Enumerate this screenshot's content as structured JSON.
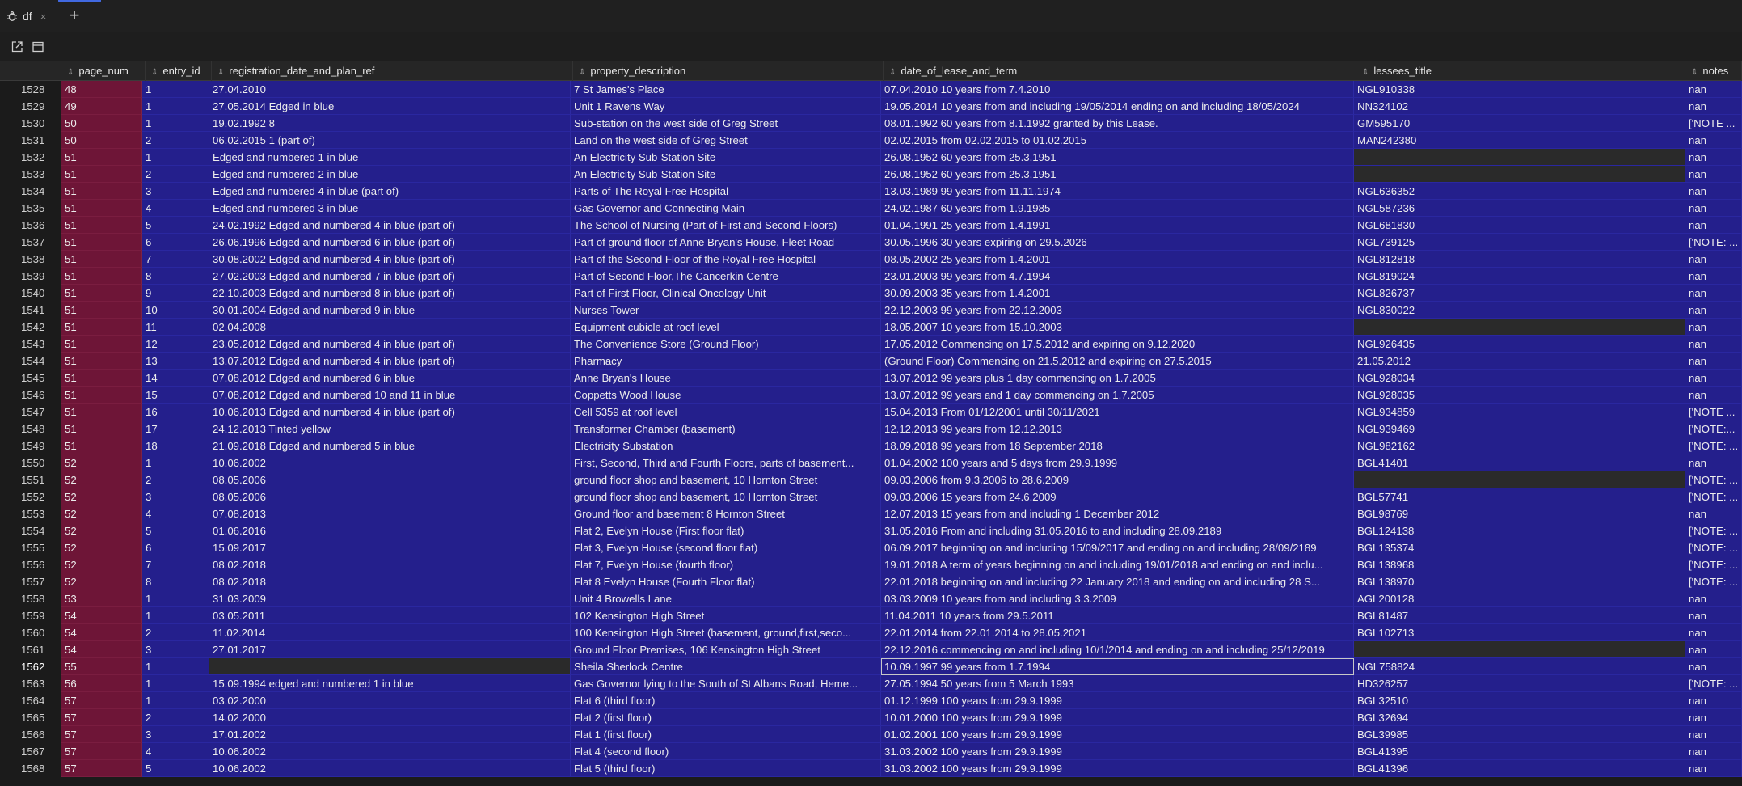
{
  "tab": {
    "title": "df",
    "close_symbol": "×",
    "new_tab_symbol": "+"
  },
  "toolbar": {
    "open_external_icon": "open-external-icon",
    "panel_icon": "panel-icon"
  },
  "columns": [
    "page_num",
    "entry_id",
    "registration_date_and_plan_ref",
    "property_description",
    "date_of_lease_and_term",
    "lessees_title",
    "notes"
  ],
  "rows": [
    [
      "1528",
      "48",
      "1",
      "27.04.2010",
      "7 St James's Place",
      "07.04.2010 10 years from 7.4.2010",
      "NGL910338",
      "nan"
    ],
    [
      "1529",
      "49",
      "1",
      "27.05.2014 Edged in blue",
      "Unit 1 Ravens Way",
      "19.05.2014 10 years from and including 19/05/2014 ending on and including 18/05/2024",
      "NN324102",
      "nan"
    ],
    [
      "1530",
      "50",
      "1",
      "19.02.1992 8",
      "Sub-station on the west side of Greg Street",
      "08.01.1992 60 years from 8.1.1992 granted by this Lease.",
      "GM595170",
      "['NOTE ..."
    ],
    [
      "1531",
      "50",
      "2",
      "06.02.2015 1 (part of)",
      "Land on the west side of Greg Street",
      "02.02.2015 from 02.02.2015 to 01.02.2015",
      "MAN242380",
      "nan"
    ],
    [
      "1532",
      "51",
      "1",
      "Edged and numbered 1 in blue",
      "An Electricity Sub-Station Site",
      "26.08.1952 60 years from 25.3.1951",
      "",
      "nan"
    ],
    [
      "1533",
      "51",
      "2",
      "Edged and numbered 2 in blue",
      "An Electricity Sub-Station Site",
      "26.08.1952 60 years from 25.3.1951",
      "",
      "nan"
    ],
    [
      "1534",
      "51",
      "3",
      "Edged and numbered 4 in blue (part of)",
      "Parts of The Royal Free Hospital",
      "13.03.1989 99 years from 11.11.1974",
      "NGL636352",
      "nan"
    ],
    [
      "1535",
      "51",
      "4",
      "Edged and numbered 3 in blue",
      "Gas Governor and Connecting Main",
      "24.02.1987 60 years from 1.9.1985",
      "NGL587236",
      "nan"
    ],
    [
      "1536",
      "51",
      "5",
      "24.02.1992 Edged and numbered 4 in blue (part of)",
      "The School of Nursing (Part of First and Second Floors)",
      "01.04.1991 25 years from 1.4.1991",
      "NGL681830",
      "nan"
    ],
    [
      "1537",
      "51",
      "6",
      "26.06.1996 Edged and numbered 6 in blue (part of)",
      "Part of ground floor of Anne Bryan's House, Fleet Road",
      "30.05.1996 30 years expiring on 29.5.2026",
      "NGL739125",
      "['NOTE: ..."
    ],
    [
      "1538",
      "51",
      "7",
      "30.08.2002 Edged and numbered 4 in blue (part of)",
      "Part of the Second Floor of the Royal Free Hospital",
      "08.05.2002 25 years from 1.4.2001",
      "NGL812818",
      "nan"
    ],
    [
      "1539",
      "51",
      "8",
      "27.02.2003 Edged and numbered 7 in blue (part of)",
      "Part of Second Floor,The Cancerkin Centre",
      "23.01.2003 99 years from 4.7.1994",
      "NGL819024",
      "nan"
    ],
    [
      "1540",
      "51",
      "9",
      "22.10.2003 Edged and numbered 8 in blue (part of)",
      "Part of First Floor, Clinical Oncology Unit",
      "30.09.2003 35 years from 1.4.2001",
      "NGL826737",
      "nan"
    ],
    [
      "1541",
      "51",
      "10",
      "30.01.2004 Edged and numbered 9 in blue",
      "Nurses Tower",
      "22.12.2003 99 years from 22.12.2003",
      "NGL830022",
      "nan"
    ],
    [
      "1542",
      "51",
      "11",
      "02.04.2008",
      "Equipment cubicle at roof level",
      "18.05.2007 10 years from 15.10.2003",
      "",
      "nan"
    ],
    [
      "1543",
      "51",
      "12",
      "23.05.2012 Edged and numbered 4 in blue (part of)",
      "The Convenience Store (Ground Floor)",
      "17.05.2012 Commencing on 17.5.2012 and expiring on 9.12.2020",
      "NGL926435",
      "nan"
    ],
    [
      "1544",
      "51",
      "13",
      "13.07.2012 Edged and numbered 4 in blue (part of)",
      "Pharmacy",
      "(Ground Floor) Commencing on 21.5.2012 and expiring on 27.5.2015",
      "21.05.2012",
      "nan"
    ],
    [
      "1545",
      "51",
      "14",
      "07.08.2012 Edged and numbered 6 in blue",
      "Anne Bryan's House",
      "13.07.2012 99 years plus 1 day commencing on 1.7.2005",
      "NGL928034",
      "nan"
    ],
    [
      "1546",
      "51",
      "15",
      "07.08.2012 Edged and numbered 10 and 11 in blue",
      "Coppetts Wood House",
      "13.07.2012 99 years and 1 day commencing on 1.7.2005",
      "NGL928035",
      "nan"
    ],
    [
      "1547",
      "51",
      "16",
      "10.06.2013 Edged and numbered 4 in blue (part of)",
      "Cell 5359 at roof level",
      "15.04.2013 From 01/12/2001 until 30/11/2021",
      "NGL934859",
      "['NOTE ..."
    ],
    [
      "1548",
      "51",
      "17",
      "24.12.2013 Tinted yellow",
      "Transformer Chamber (basement)",
      "12.12.2013 99 years from 12.12.2013",
      "NGL939469",
      "['NOTE:..."
    ],
    [
      "1549",
      "51",
      "18",
      "21.09.2018 Edged and numbered 5 in blue",
      "Electricity Substation",
      "18.09.2018 99 years from 18 September 2018",
      "NGL982162",
      "['NOTE: ..."
    ],
    [
      "1550",
      "52",
      "1",
      "10.06.2002",
      "First, Second, Third and Fourth Floors, parts of basement...",
      "01.04.2002 100 years and 5 days from 29.9.1999",
      "BGL41401",
      "nan"
    ],
    [
      "1551",
      "52",
      "2",
      "08.05.2006",
      "ground floor shop and basement, 10 Hornton Street",
      "09.03.2006 from 9.3.2006 to 28.6.2009",
      "",
      "['NOTE: ..."
    ],
    [
      "1552",
      "52",
      "3",
      "08.05.2006",
      "ground floor shop and basement, 10 Hornton Street",
      "09.03.2006 15 years from 24.6.2009",
      "BGL57741",
      "['NOTE: ..."
    ],
    [
      "1553",
      "52",
      "4",
      "07.08.2013",
      "Ground floor and basement 8 Hornton Street",
      "12.07.2013 15 years from and including 1 December 2012",
      "BGL98769",
      "nan"
    ],
    [
      "1554",
      "52",
      "5",
      "01.06.2016",
      "Flat 2, Evelyn House (First floor flat)",
      "31.05.2016 From and including 31.05.2016 to and including 28.09.2189",
      "BGL124138",
      "['NOTE: ..."
    ],
    [
      "1555",
      "52",
      "6",
      "15.09.2017",
      "Flat 3, Evelyn House (second floor flat)",
      "06.09.2017 beginning on and including 15/09/2017 and ending on and including 28/09/2189",
      "BGL135374",
      "['NOTE: ..."
    ],
    [
      "1556",
      "52",
      "7",
      "08.02.2018",
      "Flat 7, Evelyn House (fourth floor)",
      "19.01.2018 A term of years beginning on and including 19/01/2018 and ending on and inclu...",
      "BGL138968",
      "['NOTE: ..."
    ],
    [
      "1557",
      "52",
      "8",
      "08.02.2018",
      "Flat 8 Evelyn House (Fourth Floor flat)",
      "22.01.2018 beginning on and including 22 January 2018 and ending on and including 28 S...",
      "BGL138970",
      "['NOTE: ..."
    ],
    [
      "1558",
      "53",
      "1",
      "31.03.2009",
      "Unit 4 Browells Lane",
      "03.03.2009 10 years from and including 3.3.2009",
      "AGL200128",
      "nan"
    ],
    [
      "1559",
      "54",
      "1",
      "03.05.2011",
      "102 Kensington High Street",
      "11.04.2011 10 years from 29.5.2011",
      "BGL81487",
      "nan"
    ],
    [
      "1560",
      "54",
      "2",
      "11.02.2014",
      "100 Kensington High Street (basement, ground,first,seco...",
      "22.01.2014 from 22.01.2014 to 28.05.2021",
      "BGL102713",
      "nan"
    ],
    [
      "1561",
      "54",
      "3",
      "27.01.2017",
      "Ground Floor Premises, 106 Kensington High Street",
      "22.12.2016 commencing on and including 10/1/2014 and ending on and including 25/12/2019",
      "",
      "nan"
    ],
    [
      "1562",
      "55",
      "1",
      "",
      "Sheila Sherlock Centre",
      "10.09.1997 99 years from 1.7.1994",
      "NGL758824",
      "nan"
    ],
    [
      "1563",
      "56",
      "1",
      "15.09.1994 edged and numbered 1 in blue",
      "Gas Governor lying to the South of St Albans Road, Heme...",
      "27.05.1994 50 years from 5 March 1993",
      "HD326257",
      "['NOTE: ..."
    ],
    [
      "1564",
      "57",
      "1",
      "03.02.2000",
      "Flat 6 (third floor)",
      "01.12.1999 100 years from 29.9.1999",
      "BGL32510",
      "nan"
    ],
    [
      "1565",
      "57",
      "2",
      "14.02.2000",
      "Flat 2 (first floor)",
      "10.01.2000 100 years from 29.9.1999",
      "BGL32694",
      "nan"
    ],
    [
      "1566",
      "57",
      "3",
      "17.01.2002",
      "Flat 1 (first floor)",
      "01.02.2001 100 years from 29.9.1999",
      "BGL39985",
      "nan"
    ],
    [
      "1567",
      "57",
      "4",
      "10.06.2002",
      "Flat 4 (second floor)",
      "31.03.2002 100 years from 29.9.1999",
      "BGL41395",
      "nan"
    ],
    [
      "1568",
      "57",
      "5",
      "10.06.2002",
      "Flat 5 (third floor)",
      "31.03.2002 100 years from 29.9.1999",
      "BGL41396",
      "nan"
    ]
  ],
  "selected_row_index": "1562",
  "colors": {
    "cell_bg": "#241f8c",
    "page_num_bg": "#6e1537",
    "empty_cell_bg": "#2a2a2a",
    "accent": "#4169e1"
  }
}
